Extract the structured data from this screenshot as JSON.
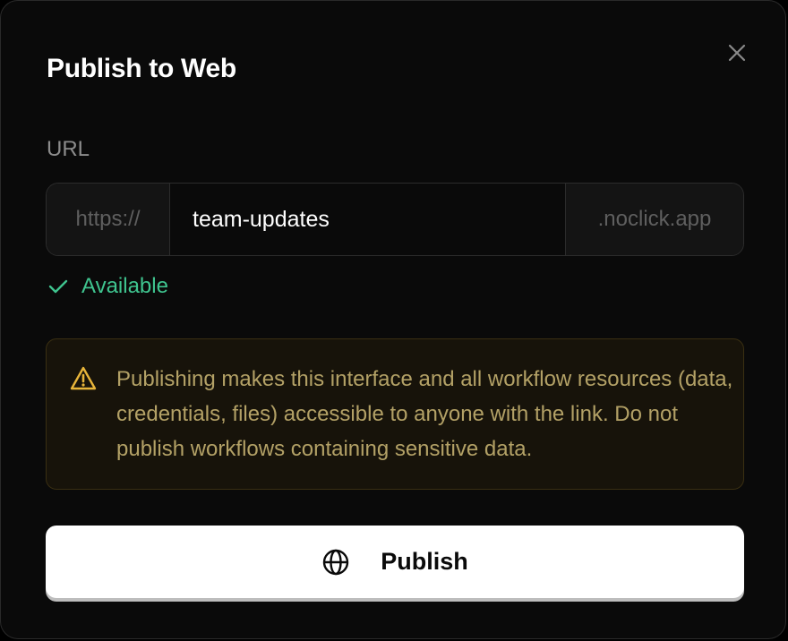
{
  "dialog": {
    "title": "Publish to Web",
    "close_icon": "close-icon"
  },
  "url": {
    "label": "URL",
    "prefix": "https://",
    "value": "team-updates",
    "suffix": ".noclick.app"
  },
  "status": {
    "icon": "check-icon",
    "text": "Available",
    "color": "#3fc48f"
  },
  "warning": {
    "icon": "warning-triangle-icon",
    "text": "Publishing makes this interface and all workflow resources (data, credentials, files) accessible to anyone with the link. Do not publish workflows containing sensitive data.",
    "color": "#b3a166",
    "accent": "#e8b53a"
  },
  "publish_button": {
    "icon": "globe-icon",
    "label": "Publish"
  }
}
